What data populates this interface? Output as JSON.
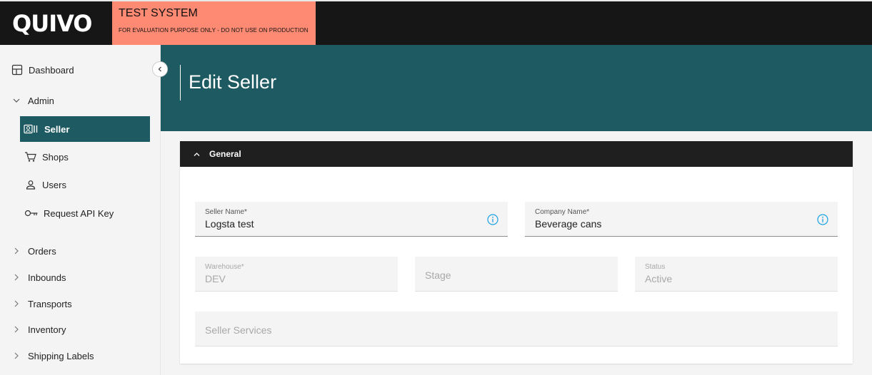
{
  "topbar": {
    "logo": "QUIVO",
    "test_title": "TEST SYSTEM",
    "test_note": "FOR EVALUATION PURPOSE ONLY - DO NOT USE ON PRODUCTION"
  },
  "sidebar": {
    "items": [
      {
        "label": "Dashboard",
        "icon": "dashboard-icon"
      },
      {
        "label": "Admin",
        "icon": "chevron-down-icon"
      },
      {
        "label": "Seller",
        "icon": "seller-icon"
      },
      {
        "label": "Shops",
        "icon": "cart-icon"
      },
      {
        "label": "Users",
        "icon": "user-icon"
      },
      {
        "label": "Request API Key",
        "icon": "key-icon"
      },
      {
        "label": "Orders",
        "icon": "chevron-right-icon"
      },
      {
        "label": "Inbounds",
        "icon": "chevron-right-icon"
      },
      {
        "label": "Transports",
        "icon": "chevron-right-icon"
      },
      {
        "label": "Inventory",
        "icon": "chevron-right-icon"
      },
      {
        "label": "Shipping Labels",
        "icon": "chevron-right-icon"
      }
    ]
  },
  "page": {
    "title": "Edit Seller"
  },
  "general": {
    "section_title": "General",
    "seller_name": {
      "label": "Seller Name*",
      "value": "Logsta test"
    },
    "company_name": {
      "label": "Company Name*",
      "value": "Beverage cans"
    },
    "warehouse": {
      "label": "Warehouse*",
      "value": "DEV"
    },
    "stage": {
      "placeholder": "Stage"
    },
    "status": {
      "label": "Status",
      "value": "Active"
    },
    "seller_services": {
      "placeholder": "Seller Services"
    }
  },
  "colors": {
    "accent": "#1e5a61",
    "banner": "#ff8a73",
    "topbar": "#161616",
    "info": "#1ba1e2"
  }
}
